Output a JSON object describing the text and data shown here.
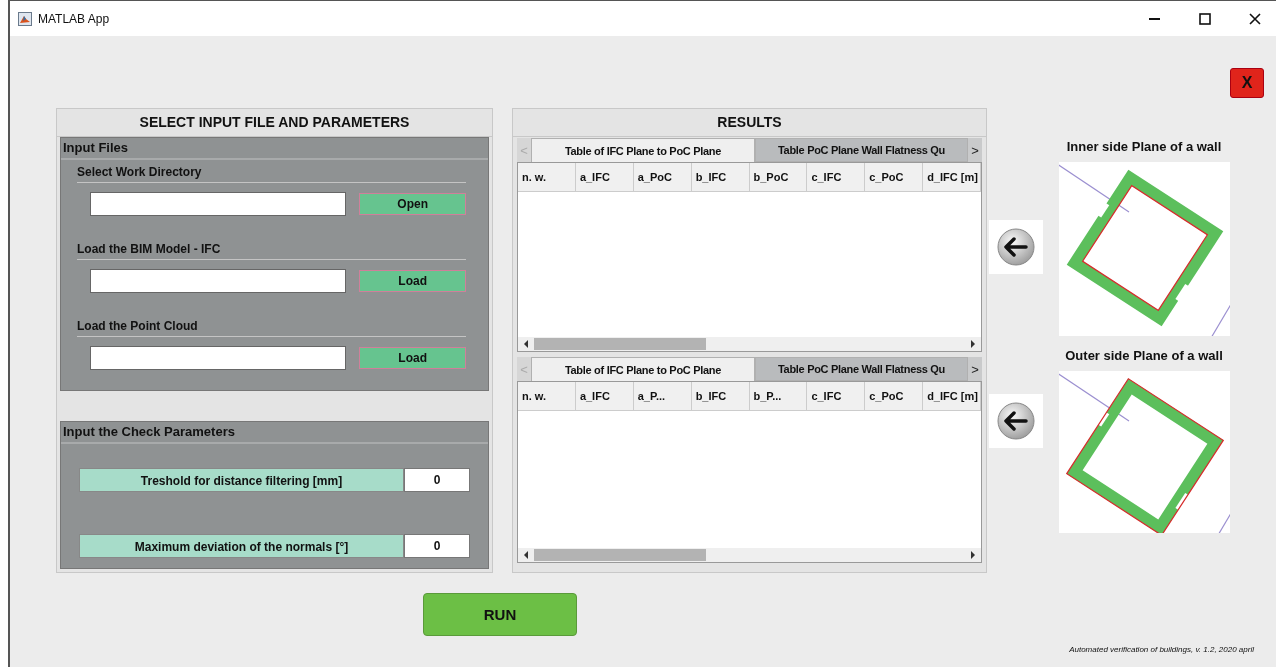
{
  "window": {
    "title": "MATLAB App"
  },
  "close_app_button": {
    "label": "X"
  },
  "input_panel": {
    "title": "SELECT INPUT FILE AND PARAMETERS",
    "files_group": {
      "title": "Input Files",
      "items": [
        {
          "label": "Select Work Directory",
          "button": "Open"
        },
        {
          "label": "Load the BIM Model - IFC",
          "button": "Load"
        },
        {
          "label": "Load the Point Cloud",
          "button": "Load"
        }
      ]
    },
    "check_group": {
      "title": "Input the Check Parameters",
      "items": [
        {
          "label": "Treshold for distance filtering [mm]",
          "value": "0"
        },
        {
          "label": "Maximum deviation of the normals [°]",
          "value": "0"
        }
      ]
    }
  },
  "results_panel": {
    "title": "RESULTS",
    "tables": [
      {
        "scroll_left": {
          "label": "<",
          "disabled": true
        },
        "scroll_right": {
          "label": ">",
          "disabled": false
        },
        "tabs": [
          {
            "label": "Table of IFC Plane to PoC Plane",
            "selected": true
          },
          {
            "label": "Table PoC Plane Wall Flatness Qu",
            "selected": false
          }
        ],
        "columns": [
          "n. w.",
          "a_IFC",
          "a_PoC",
          "b_IFC",
          "b_PoC",
          "c_IFC",
          "c_PoC",
          "d_IFC [m]"
        ]
      },
      {
        "scroll_left": {
          "label": "<",
          "disabled": true
        },
        "scroll_right": {
          "label": ">",
          "disabled": false
        },
        "tabs": [
          {
            "label": "Table of IFC Plane to PoC Plane",
            "selected": true
          },
          {
            "label": "Table PoC Plane Wall Flatness Qu",
            "selected": false
          }
        ],
        "columns": [
          "n. w.",
          "a_IFC",
          "a_P...",
          "b_IFC",
          "b_P...",
          "c_IFC",
          "c_PoC",
          "d_IFC [m]"
        ]
      }
    ]
  },
  "views": [
    {
      "title": "Inner side Plane of a wall",
      "kind": "inner"
    },
    {
      "title": "Outer side Plane of a wall",
      "kind": "outer"
    }
  ],
  "run_button": {
    "label": "RUN"
  },
  "footer": "Automated verification of buildings, v. 1.2, 2020 april"
}
